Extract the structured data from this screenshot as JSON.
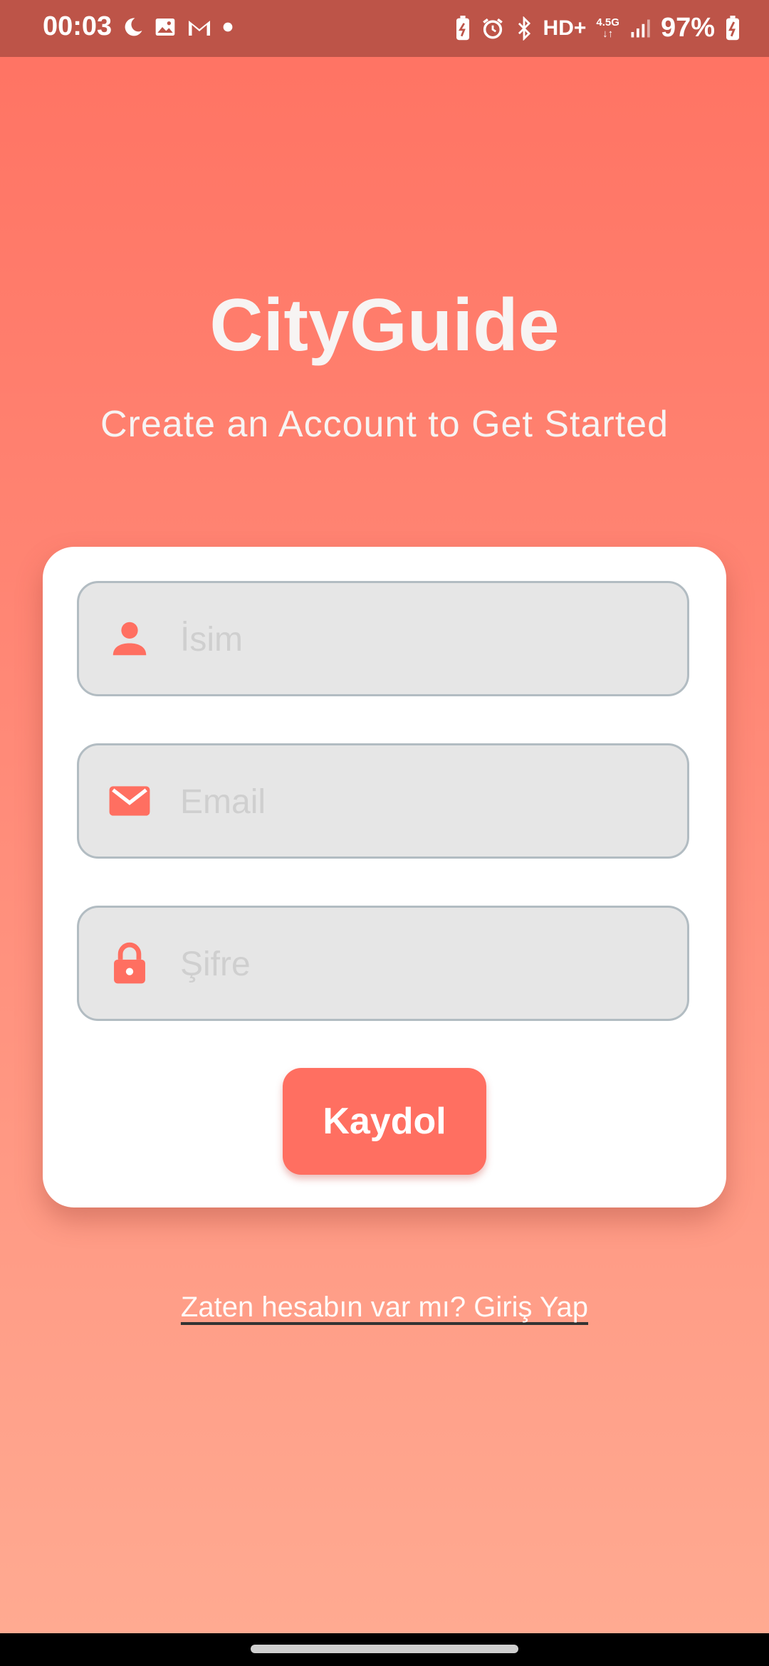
{
  "status_bar": {
    "time": "00:03",
    "battery_percent": "97%",
    "network_label": "HD+",
    "network_type": "4.5G",
    "left_icons": [
      "moon-icon",
      "gallery-icon",
      "gmail-icon",
      "dot-icon"
    ],
    "right_icons": [
      "battery-saver-icon",
      "alarm-icon",
      "bluetooth-icon",
      "hd-icon",
      "signal-icon",
      "battery-charging-icon"
    ]
  },
  "app": {
    "title": "CityGuide",
    "subtitle": "Create an Account to Get Started"
  },
  "form": {
    "name_placeholder": "İsim",
    "email_placeholder": "Email",
    "password_placeholder": "Şifre",
    "name_value": "",
    "email_value": "",
    "password_value": "",
    "submit_label": "Kaydol"
  },
  "login_link": "Zaten hesabın var mı? Giriş Yap",
  "colors": {
    "accent": "#ff6f61",
    "status_bar": "#bd5448",
    "gradient_top": "#ff7262",
    "gradient_bottom": "#ffab92",
    "field_bg": "#e6e6e6"
  }
}
